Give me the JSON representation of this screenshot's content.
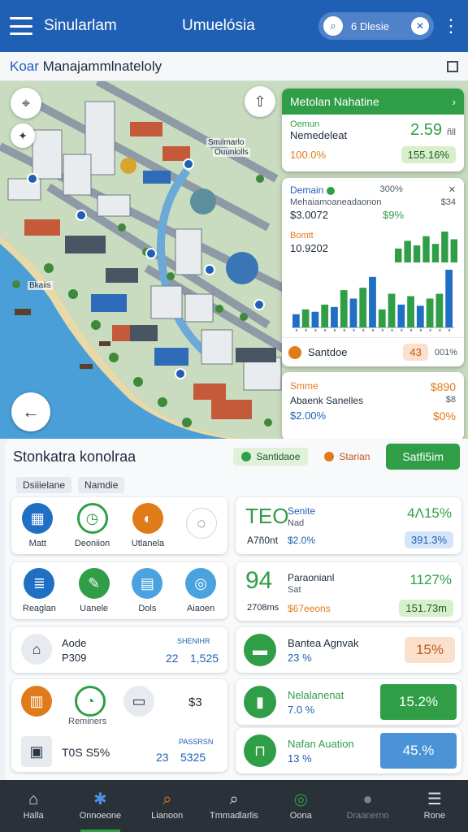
{
  "appbar": {
    "title": "Sinularlam",
    "center_title": "Umuelósia",
    "search_text": "6 Dlesie",
    "menu_icon": "hamburger-icon",
    "search_icon": "search-icon",
    "clear_icon": "close-icon",
    "more_icon": "more-vertical-icon"
  },
  "subheader": {
    "prefix": "Koar",
    "title": "Manajammlnateloly",
    "icon": "grid-icon"
  },
  "map": {
    "labels": [
      "Bkaiis",
      "Smilmarlo",
      "Ouunlolls"
    ]
  },
  "card1": {
    "header": "Metolan Nahatine",
    "label_small": "Oemun",
    "label": "Nemedeleat",
    "value": "2.59",
    "unit": "ñll",
    "percent": "100.0%",
    "pill": "155.16%"
  },
  "card2": {
    "title": "Demain",
    "pct_small": "300%",
    "sub": "Mehaiamoaneadaonon",
    "sub_small": "$34",
    "value1": "$3.0072",
    "value1_right": "$9%",
    "label2": "Bomtt",
    "value2": "10.9202",
    "footer_label": "Santdoe",
    "footer_value": "43",
    "footer_right": "001%",
    "bars": [
      {
        "h": 0.22,
        "c": "#1f6fc5"
      },
      {
        "h": 0.3,
        "c": "#2f9e46"
      },
      {
        "h": 0.26,
        "c": "#1f6fc5"
      },
      {
        "h": 0.38,
        "c": "#2f9e46"
      },
      {
        "h": 0.34,
        "c": "#1f6fc5"
      },
      {
        "h": 0.62,
        "c": "#2f9e46"
      },
      {
        "h": 0.48,
        "c": "#1f6fc5"
      },
      {
        "h": 0.66,
        "c": "#2f9e46"
      },
      {
        "h": 0.84,
        "c": "#1f6fc5"
      },
      {
        "h": 0.3,
        "c": "#2f9e46"
      },
      {
        "h": 0.56,
        "c": "#2f9e46"
      },
      {
        "h": 0.38,
        "c": "#1f6fc5"
      },
      {
        "h": 0.52,
        "c": "#2f9e46"
      },
      {
        "h": 0.36,
        "c": "#1f6fc5"
      },
      {
        "h": 0.48,
        "c": "#2f9e46"
      },
      {
        "h": 0.56,
        "c": "#2f9e46"
      },
      {
        "h": 0.96,
        "c": "#1f6fc5"
      }
    ],
    "mini_bars": [
      0.45,
      0.7,
      0.55,
      0.85,
      0.6,
      1.0,
      0.75
    ]
  },
  "card3": {
    "title": "Smme",
    "label": "Abaenk Sanelles",
    "value_left": "$2.00%",
    "value_right_top": "$890",
    "value_right_mid": "$8",
    "value_right": "$0%"
  },
  "panel": {
    "title": "Stonkatra konolraa",
    "chip_green": "Santidaoe",
    "chip_orange": "Starian",
    "action": "Satfi5im",
    "tags": [
      "Dsiiielane",
      "Namdie"
    ]
  },
  "tiles": {
    "t1": [
      {
        "label": "Matt",
        "icon": "building-icon",
        "color": "#1f6fc5"
      },
      {
        "label": "Deoniion",
        "icon": "clock-icon",
        "color": "#2f9e46"
      },
      {
        "label": "Utlanela",
        "icon": "globe-icon",
        "color": "#e07b1a"
      },
      {
        "label": "",
        "icon": "chat-icon",
        "color": "#ffffff"
      }
    ],
    "t2": [
      {
        "label": "Reaglan",
        "icon": "document-icon",
        "color": "#1f6fc5"
      },
      {
        "label": "Uanele",
        "icon": "wrench-icon",
        "color": "#2f9e46"
      },
      {
        "label": "Dols",
        "icon": "map-icon",
        "color": "#4aa3df"
      },
      {
        "label": "Aiaoen",
        "icon": "compass-icon",
        "color": "#4aa3df"
      }
    ],
    "t3": {
      "title": "Aode",
      "sub": "P309",
      "value": "22",
      "value2": "1,525",
      "small": "SHENIHR"
    },
    "t4": {
      "label": "Reminers",
      "value": "$3",
      "sub": "T0S S5%",
      "value_a": "23",
      "value_b": "5325",
      "small": "PASSRSN"
    },
    "r1": {
      "big": "ТЕО",
      "label": "Senite",
      "label2": "Nad",
      "value": "4Ʌ15%",
      "sub": "A7ñ0nt",
      "sub_value": "$2.0%",
      "pill": "391.3%"
    },
    "r2": {
      "big": "94",
      "label": "Paraonianl",
      "label2": "Sat",
      "value": "1127%",
      "sub": "2708ms",
      "sub_value": "$67eeons",
      "pill": "151.73m"
    },
    "r3": {
      "label": "Bantea Agnvak",
      "value": "23 %",
      "pill": "15%"
    },
    "r4": {
      "label": "Nelalanenat",
      "value": "7.0 %",
      "pill": "15.2%"
    },
    "r5": {
      "label": "Nafan Auation",
      "value": "13 %",
      "pill": "45.%"
    }
  },
  "nav": [
    {
      "label": "Halla",
      "icon": "home-icon",
      "active": false
    },
    {
      "label": "Onnoeone",
      "icon": "puzzle-icon",
      "active": true
    },
    {
      "label": "Lianoon",
      "icon": "search-icon",
      "active": false
    },
    {
      "label": "Tmmadlarlis",
      "icon": "search-icon",
      "active": false
    },
    {
      "label": "Oona",
      "icon": "target-icon",
      "active": false
    },
    {
      "label": "Draanerno",
      "icon": "circle-icon",
      "active": false
    },
    {
      "label": "Rone",
      "icon": "menu-icon",
      "active": false
    }
  ]
}
